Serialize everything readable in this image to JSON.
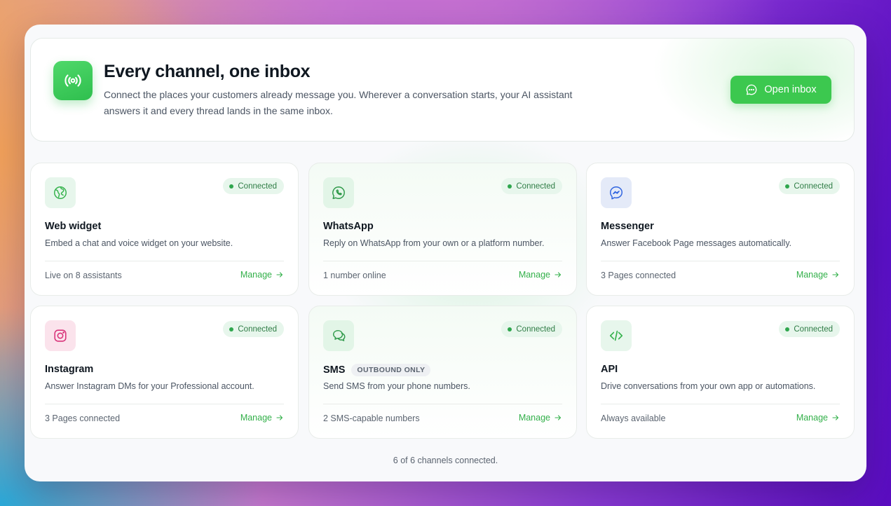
{
  "hero": {
    "title": "Every channel, one inbox",
    "description": "Connect the places your customers already message you. Wherever a conversation starts, your AI assistant answers it and every thread lands in the same inbox.",
    "open_button": "Open inbox",
    "icon": "broadcast-icon"
  },
  "channels": [
    {
      "name": "Web widget",
      "icon": "globe-icon",
      "badge": "Connected",
      "description": "Embed a chat and voice widget on your website.",
      "status": "Live on 8 assistants",
      "manage": "Manage"
    },
    {
      "name": "WhatsApp",
      "icon": "whatsapp-icon",
      "badge": "Connected",
      "description": "Reply on WhatsApp from your own or a platform number.",
      "status": "1 number online",
      "manage": "Manage"
    },
    {
      "name": "Messenger",
      "icon": "messenger-icon",
      "badge": "Connected",
      "description": "Answer Facebook Page messages automatically.",
      "status": "3 Pages connected",
      "manage": "Manage"
    },
    {
      "name": "Instagram",
      "icon": "instagram-icon",
      "badge": "Connected",
      "description": "Answer Instagram DMs for your Professional account.",
      "status": "3 Pages connected",
      "manage": "Manage"
    },
    {
      "name": "SMS",
      "tag": "OUTBOUND ONLY",
      "icon": "sms-chat-icon",
      "badge": "Connected",
      "description": "Send SMS from your phone numbers.",
      "status": "2 SMS-capable numbers",
      "manage": "Manage"
    },
    {
      "name": "API",
      "icon": "code-icon",
      "badge": "Connected",
      "description": "Drive conversations from your own app or automations.",
      "status": "Always available",
      "manage": "Manage"
    }
  ],
  "footer": "6 of 6 channels connected.",
  "colors": {
    "accent": "#3cc84f",
    "badge_bg": "#e7f6ec",
    "badge_text": "#2f7d46"
  }
}
